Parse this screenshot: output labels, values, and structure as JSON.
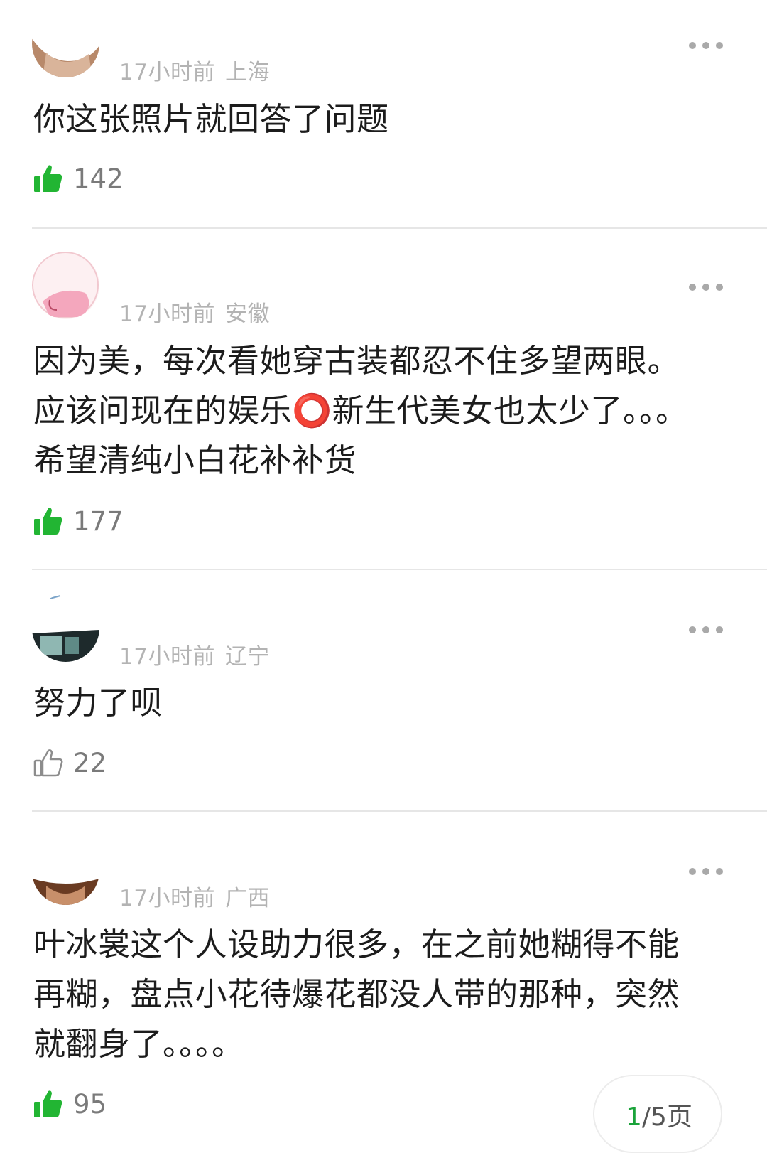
{
  "comments": [
    {
      "time": "17小时前",
      "location": "上海",
      "lines": [
        "你这张照片就回答了问题"
      ],
      "likes": "142",
      "liked": true
    },
    {
      "time": "17小时前",
      "location": "安徽",
      "lines": [
        "因为美，每次看她穿古装都忍不住多望两眼。",
        "应该问现在的娱乐⭕新生代美女也太少了。。。",
        "希望清纯小白花补补货"
      ],
      "likes": "177",
      "liked": true
    },
    {
      "time": "17小时前",
      "location": "辽宁",
      "lines": [
        "努力了呗"
      ],
      "likes": "22",
      "liked": false
    },
    {
      "time": "17小时前",
      "location": "广西",
      "lines": [
        "叶冰裳这个人设助力很多，在之前她糊得不能",
        "再糊，盘点小花待爆花都没人带的那种，突然",
        "就翻身了。。。。"
      ],
      "likes": "95",
      "liked": true
    }
  ],
  "pager": {
    "current": "1",
    "rest": "/5页"
  },
  "colors": {
    "like_green": "#22b533",
    "meta_gray": "#b3b3b3"
  },
  "icons": {
    "like_filled": "thumbs-up-filled-icon",
    "like_outline": "thumbs-up-outline-icon",
    "more": "more-dots-icon"
  }
}
